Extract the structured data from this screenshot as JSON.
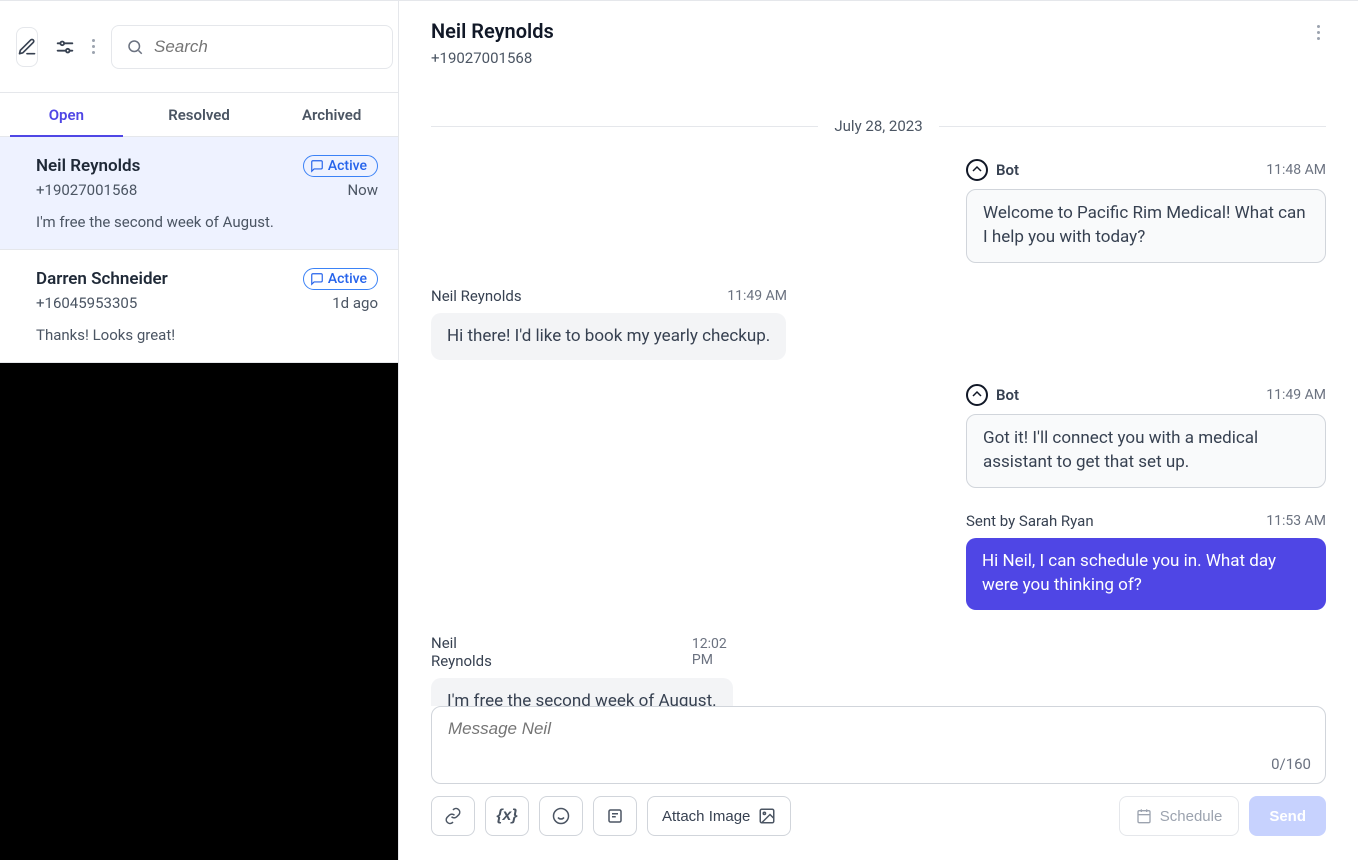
{
  "search": {
    "placeholder": "Search"
  },
  "tabs": {
    "open": "Open",
    "resolved": "Resolved",
    "archived": "Archived"
  },
  "conversations": [
    {
      "name": "Neil Reynolds",
      "phone": "+19027001568",
      "badge": "Active",
      "time": "Now",
      "preview": "I'm free the second week of August."
    },
    {
      "name": "Darren Schneider",
      "phone": "+16045953305",
      "badge": "Active",
      "time": "1d ago",
      "preview": "Thanks! Looks great!"
    }
  ],
  "chat_header": {
    "name": "Neil Reynolds",
    "phone": "+19027001568"
  },
  "date_separator": "July 28, 2023",
  "messages": {
    "m0": {
      "sender": "Bot",
      "time": "11:48 AM",
      "text": "Welcome to Pacific Rim Medical! What can I help you with today?"
    },
    "m1": {
      "sender": "Neil Reynolds",
      "time": "11:49 AM",
      "text": "Hi there! I'd like to book my yearly checkup."
    },
    "m2": {
      "sender": "Bot",
      "time": "11:49 AM",
      "text": "Got it! I'll connect you with a medical assistant to get that set up."
    },
    "m3": {
      "sender": "Sent by Sarah Ryan",
      "time": "11:53 AM",
      "text": "Hi Neil, I can schedule you in. What day were you thinking of?"
    },
    "m4": {
      "sender": "Neil Reynolds",
      "time": "12:02 PM",
      "text": "I'm free the second week of August."
    }
  },
  "composer": {
    "placeholder": "Message Neil",
    "char_count": "0/160",
    "attach_label": "Attach Image",
    "schedule_label": "Schedule",
    "send_label": "Send"
  }
}
